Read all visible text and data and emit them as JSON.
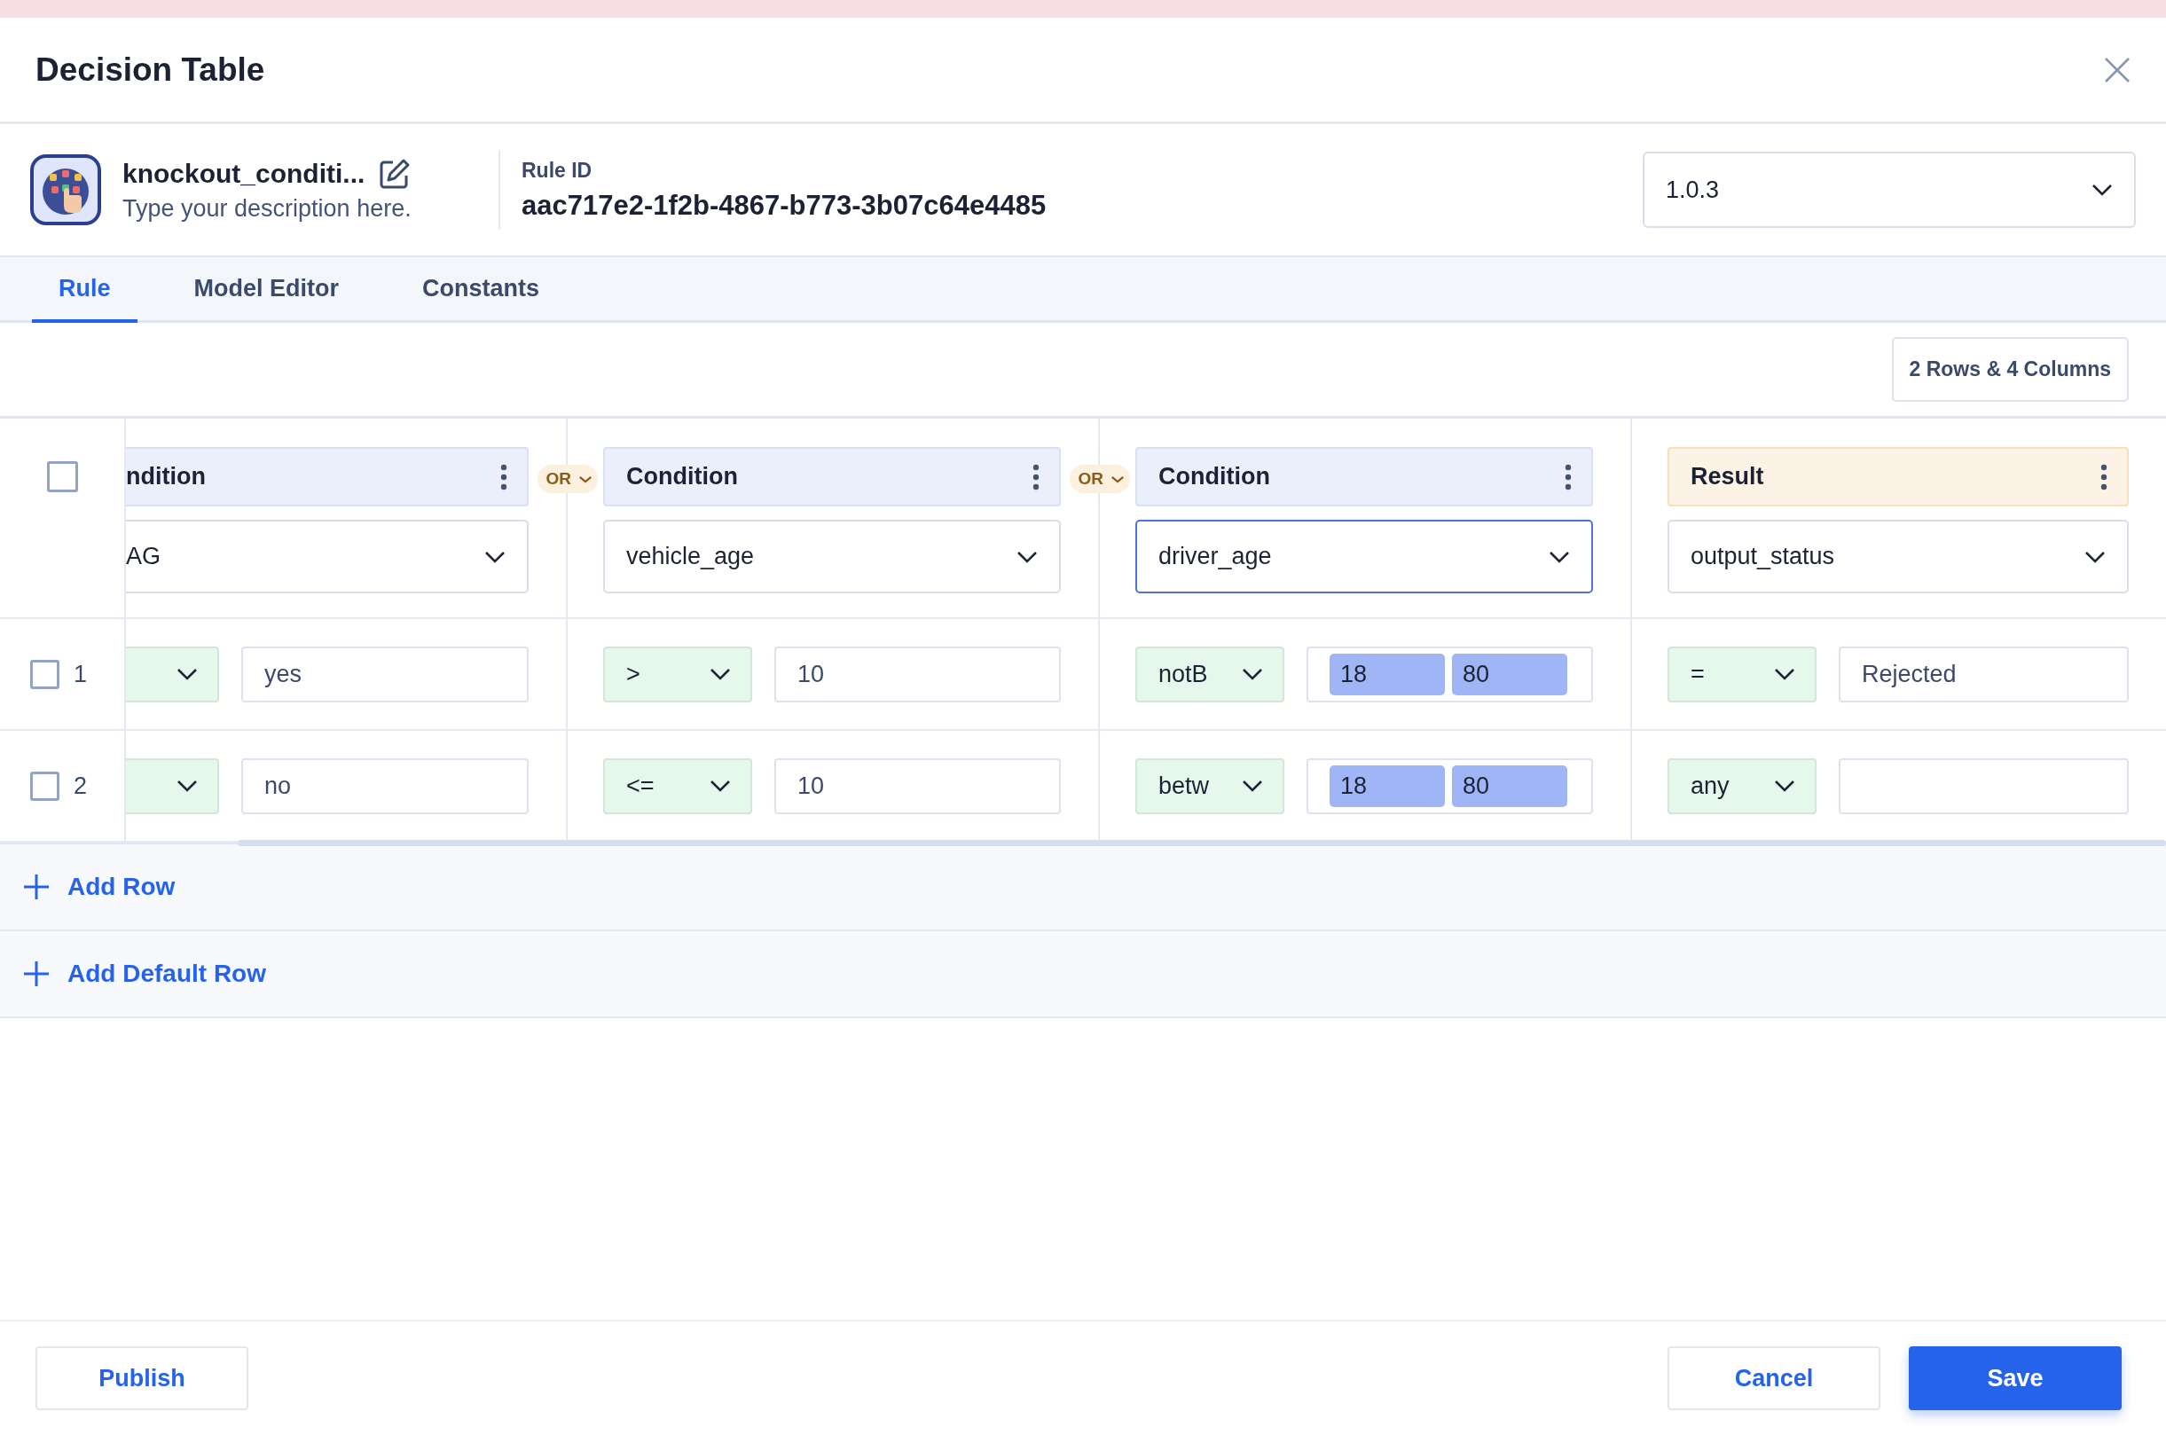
{
  "window": {
    "title": "Decision Table"
  },
  "rule": {
    "name": "knockout_conditi...",
    "description": {
      "placeholder": "Type your description here."
    },
    "id_label": "Rule ID",
    "id": "aac717e2-1f2b-4867-b773-3b07c64e4485",
    "version": "1.0.3"
  },
  "tabs": [
    {
      "label": "Rule",
      "selected": true
    },
    {
      "label": "Model Editor",
      "selected": false
    },
    {
      "label": "Constants",
      "selected": false
    }
  ],
  "summary": "2 Rows & 4 Columns",
  "table": {
    "all_checked": false,
    "columns": [
      {
        "kind": "condition",
        "header": "ndition",
        "field": "AG",
        "focused": false,
        "joiner": "OR",
        "clipped": true
      },
      {
        "kind": "condition",
        "header": "Condition",
        "field": "vehicle_age",
        "focused": false,
        "joiner": "OR",
        "clipped": false
      },
      {
        "kind": "condition",
        "header": "Condition",
        "field": "driver_age",
        "focused": true,
        "clipped": false
      },
      {
        "kind": "result",
        "header": "Result",
        "field": "output_status",
        "focused": false,
        "clipped": false
      }
    ],
    "rows": [
      {
        "number": "1",
        "checked": false,
        "cells": [
          {
            "kind": "single",
            "value": "yes"
          },
          {
            "kind": "single",
            "operator": ">",
            "value": "10"
          },
          {
            "kind": "range",
            "operator": "notB",
            "values": [
              "18",
              "80"
            ]
          },
          {
            "kind": "single",
            "operator": "=",
            "value": "Rejected"
          }
        ]
      },
      {
        "number": "2",
        "checked": false,
        "cells": [
          {
            "kind": "single",
            "value": "no"
          },
          {
            "kind": "single",
            "operator": "<=",
            "value": "10"
          },
          {
            "kind": "range",
            "operator": "betw",
            "values": [
              "18",
              "80"
            ]
          },
          {
            "kind": "single",
            "operator": "any"
          }
        ]
      }
    ]
  },
  "add_row": "Add Row",
  "add_default_row": "Add Default Row",
  "footer": {
    "publish": "Publish",
    "cancel": "Cancel",
    "save": "Save"
  }
}
